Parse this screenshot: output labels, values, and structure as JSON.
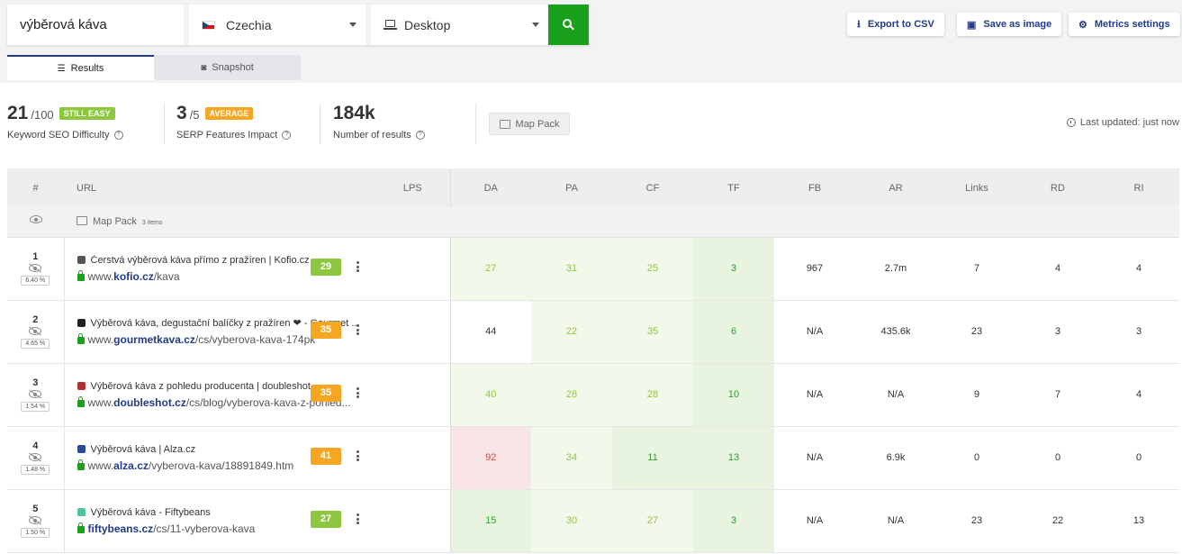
{
  "search": {
    "keyword": "výběrová káva",
    "country": "Czechia",
    "device": "Desktop"
  },
  "actions": {
    "export": "Export to CSV",
    "save": "Save as image",
    "metrics": "Metrics settings"
  },
  "tabs": {
    "results": "Results",
    "snapshot": "Snapshot"
  },
  "stats": {
    "difficulty": {
      "value": "21",
      "of": "/100",
      "badge": "STILL EASY",
      "label": "Keyword SEO Difficulty"
    },
    "serp": {
      "value": "3",
      "of": "/5",
      "badge": "AVERAGE",
      "label": "SERP Features Impact"
    },
    "results": {
      "value": "184k",
      "label": "Number of results"
    },
    "mappack": "Map Pack",
    "updated": "Last updated: just now"
  },
  "columns": [
    "#",
    "URL",
    "LPS",
    "DA",
    "PA",
    "CF",
    "TF",
    "FB",
    "AR",
    "Links",
    "RD",
    "RI"
  ],
  "mappack_row": {
    "label": "Map Pack",
    "count": "3 items"
  },
  "rows": [
    {
      "rank": "1",
      "pct": "6.40 %",
      "title": "Čerstvá výběrová káva přímo z pražíren | Kofio.cz",
      "url_pre": "www.",
      "url_domain": "kofio.cz",
      "url_path": "/kava",
      "lps": "29",
      "lps_color": "#8dc63f",
      "fav_color": "#555555",
      "da": "27",
      "pa": "31",
      "cf": "25",
      "tf": "3",
      "fb": "967",
      "ar": "2.7m",
      "links": "7",
      "rd": "4",
      "ri": "4"
    },
    {
      "rank": "2",
      "pct": "4.65 %",
      "title": "Výběrová káva, degustační balíčky z pražíren ❤ - Gourmet ...",
      "url_pre": "www.",
      "url_domain": "gourmetkava.cz",
      "url_path": "/cs/vyberova-kava-174pk",
      "lps": "35",
      "lps_color": "#f5a623",
      "fav_color": "#222222",
      "da": "44",
      "pa": "22",
      "cf": "35",
      "tf": "6",
      "fb": "N/A",
      "ar": "435.6k",
      "links": "23",
      "rd": "3",
      "ri": "3"
    },
    {
      "rank": "3",
      "pct": "1.54 %",
      "title": "Výběrová káva z pohledu producenta | doubleshot",
      "url_pre": "www.",
      "url_domain": "doubleshot.cz",
      "url_path": "/cs/blog/vyberova-kava-z-pohled...",
      "lps": "35",
      "lps_color": "#f5a623",
      "fav_color": "#b03030",
      "da": "40",
      "pa": "28",
      "cf": "28",
      "tf": "10",
      "fb": "N/A",
      "ar": "N/A",
      "links": "9",
      "rd": "7",
      "ri": "4"
    },
    {
      "rank": "4",
      "pct": "1.48 %",
      "title": "Výběrová káva | Alza.cz",
      "url_pre": "www.",
      "url_domain": "alza.cz",
      "url_path": "/vyberova-kava/18891849.htm",
      "lps": "41",
      "lps_color": "#f5a623",
      "fav_color": "#2b4a9a",
      "da": "92",
      "pa": "34",
      "cf": "11",
      "tf": "13",
      "fb": "N/A",
      "ar": "6.9k",
      "links": "0",
      "rd": "0",
      "ri": "0"
    },
    {
      "rank": "5",
      "pct": "1.50 %",
      "title": "Výběrová káva - Fiftybeans",
      "url_pre": "",
      "url_domain": "fiftybeans.cz",
      "url_path": "/cs/11-vyberova-kava",
      "lps": "27",
      "lps_color": "#8dc63f",
      "fav_color": "#4fc3a1",
      "da": "15",
      "pa": "30",
      "cf": "27",
      "tf": "3",
      "fb": "N/A",
      "ar": "N/A",
      "links": "23",
      "rd": "22",
      "ri": "13"
    }
  ],
  "cell_styles": {
    "da": [
      "lg",
      "d",
      "lg",
      "r",
      "g"
    ],
    "pa": [
      "lg",
      "lg",
      "lg",
      "lg",
      "lg"
    ],
    "cf": [
      "lg",
      "lg",
      "lg",
      "g",
      "lg"
    ],
    "tf": [
      "g",
      "g",
      "g",
      "g",
      "g"
    ]
  },
  "colors": {
    "accent": "#1aa01a",
    "brand": "#1f3b8a",
    "easy": "#8dc63f",
    "average": "#f5a623"
  }
}
